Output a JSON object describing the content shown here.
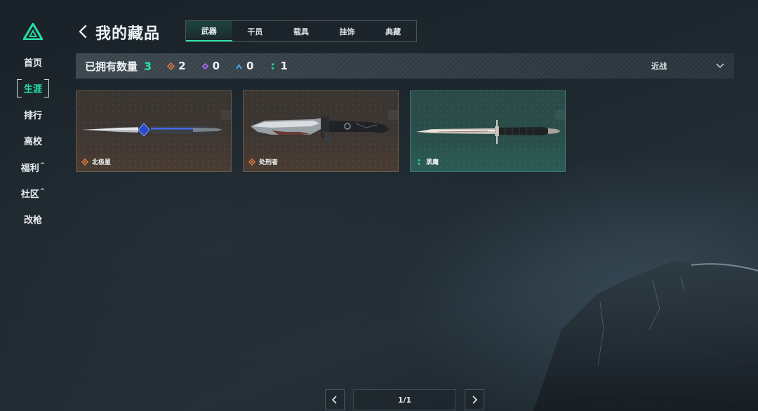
{
  "sidebar": {
    "items": [
      {
        "label": "首页",
        "active": false,
        "caret": ""
      },
      {
        "label": "生涯",
        "active": true,
        "caret": ""
      },
      {
        "label": "排行",
        "active": false,
        "caret": ""
      },
      {
        "label": "高校",
        "active": false,
        "caret": ""
      },
      {
        "label": "福利",
        "active": false,
        "caret": "^"
      },
      {
        "label": "社区",
        "active": false,
        "caret": "^"
      },
      {
        "label": "改枪",
        "active": false,
        "caret": ""
      }
    ]
  },
  "header": {
    "title": "我的藏品",
    "tabs": [
      {
        "label": "武器",
        "active": true
      },
      {
        "label": "干员",
        "active": false
      },
      {
        "label": "载具",
        "active": false
      },
      {
        "label": "挂饰",
        "active": false
      },
      {
        "label": "典藏",
        "active": false
      }
    ]
  },
  "stats": {
    "label": "已拥有数量",
    "total": "3",
    "rarities": [
      {
        "icon": "orange-diamond-icon",
        "color": "#e07a3a",
        "count": "2"
      },
      {
        "icon": "purple-diamond-icon",
        "color": "#9a6be0",
        "count": "0"
      },
      {
        "icon": "blue-triangle-icon",
        "color": "#4a9ae0",
        "count": "0"
      },
      {
        "icon": "green-dots-icon",
        "color": "#27e0a3",
        "count": "1"
      }
    ],
    "filter_label": "近战"
  },
  "cards": [
    {
      "name": "北极星",
      "rarity": "orange",
      "rarity_color": "#e07a3a",
      "weapon": "polaris-dagger-icon"
    },
    {
      "name": "处刑者",
      "rarity": "orange",
      "rarity_color": "#e07a3a",
      "weapon": "executioner-knife-icon"
    },
    {
      "name": "黑鹰",
      "rarity": "green",
      "rarity_color": "#27e0a3",
      "weapon": "blackhawk-bayonet-icon"
    }
  ],
  "pager": {
    "page": "1/1"
  },
  "colors": {
    "accent": "#27e0a3",
    "orange_rarity": "#e07a3a",
    "purple_rarity": "#9a6be0",
    "blue_rarity": "#4a9ae0"
  }
}
